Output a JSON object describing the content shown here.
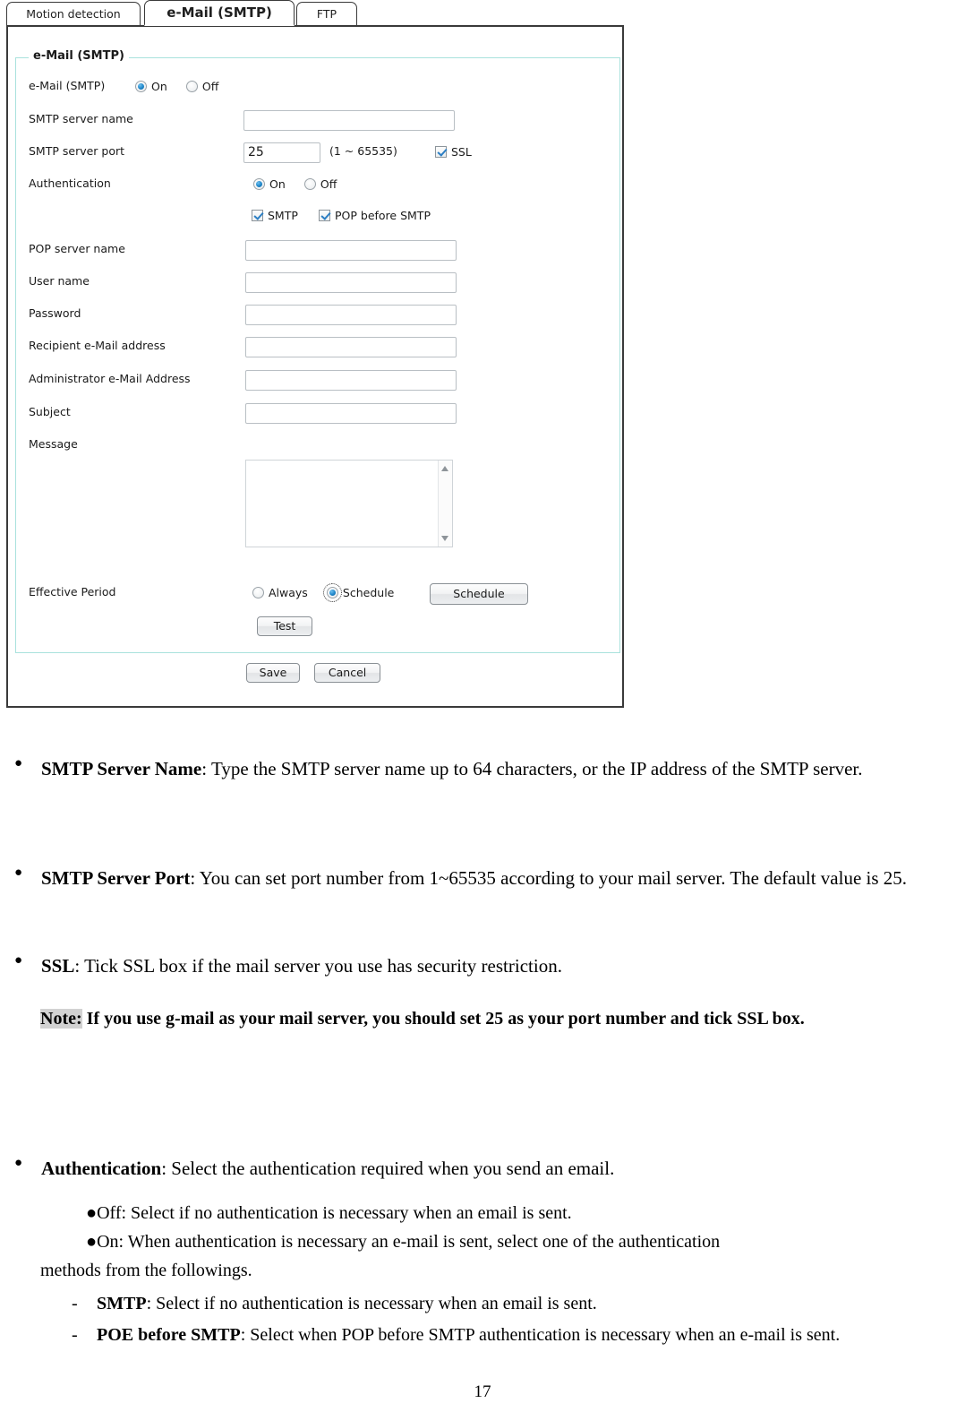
{
  "screenshot": {
    "tabs": [
      {
        "label": "Motion detection",
        "active": false
      },
      {
        "label": "e-Mail (SMTP)",
        "active": true
      },
      {
        "label": "FTP",
        "active": false
      }
    ],
    "fieldset_legend": "e-Mail (SMTP)",
    "colors": {
      "fieldset_border": "#a9e2dd",
      "panel_border": "#3a3a3a",
      "radio_selected": "#1f86c9",
      "checkbox_tick": "#2c7fc4",
      "note_highlight": "#d2d2d2"
    },
    "rows": {
      "email_toggle": {
        "label": "e-Mail (SMTP)",
        "options": [
          {
            "label": "On",
            "selected": true
          },
          {
            "label": "Off",
            "selected": false
          }
        ]
      },
      "smtp_server_name": {
        "label": "SMTP server name",
        "value": "",
        "placeholder": ""
      },
      "smtp_server_port": {
        "label": "SMTP server port",
        "value": "25",
        "range_hint": "(1 ~ 65535)",
        "ssl": {
          "label": "SSL",
          "checked": true
        }
      },
      "authentication": {
        "label": "Authentication",
        "options": [
          {
            "label": "On",
            "selected": true
          },
          {
            "label": "Off",
            "selected": false
          }
        ],
        "methods": [
          {
            "label": "SMTP",
            "checked": true
          },
          {
            "label": "POP before SMTP",
            "checked": true
          }
        ]
      },
      "pop_server_name": {
        "label": "POP server name",
        "value": ""
      },
      "user_name": {
        "label": "User name",
        "value": ""
      },
      "password": {
        "label": "Password",
        "value": ""
      },
      "recipient_email": {
        "label": "Recipient e-Mail address",
        "value": ""
      },
      "administrator_email": {
        "label": "Administrator e-Mail Address",
        "value": ""
      },
      "subject": {
        "label": "Subject",
        "value": ""
      },
      "message": {
        "label": "Message",
        "value": ""
      },
      "effective_period": {
        "label": "Effective Period",
        "options": [
          {
            "label": "Always",
            "selected": false
          },
          {
            "label": "Schedule",
            "selected": true
          }
        ],
        "schedule_button": "Schedule"
      },
      "test_button": "Test"
    },
    "footer_buttons": {
      "save": "Save",
      "cancel": "Cancel"
    }
  },
  "document": {
    "bullets": [
      {
        "glyph": "●",
        "term": "SMTP Server Name",
        "text": ": Type the SMTP server name up to 64 characters, or the IP address of the SMTP server."
      },
      {
        "glyph": "●",
        "term": "SMTP Server Port",
        "text": ": You can set port number from 1~65535 according to your mail server. The default value is 25."
      },
      {
        "glyph": "●",
        "term": "SSL",
        "text": ": Tick SSL box if the mail server you use has security restriction."
      }
    ],
    "note": {
      "label": "Note:",
      "text": " If you use g-mail as your mail server, you should set 25 as your port number and tick SSL box."
    },
    "auth_bullet": {
      "glyph": "●",
      "term": "Authentication",
      "text": ": Select the authentication required when you send an email."
    },
    "auth_sub_lines": [
      "●Off: Select if no authentication is necessary when an email is sent.",
      "●On: When authentication is necessary an e-mail is sent, select one of the authentication",
      "methods from the followings."
    ],
    "auth_dash_items": [
      {
        "dash": "-",
        "term": "SMTP",
        "text": ": Select if no authentication is necessary when an email is sent."
      },
      {
        "dash": "-",
        "term": "POE before SMTP",
        "text": ": Select when POP before SMTP authentication is necessary when an e-mail is sent."
      }
    ],
    "page_number": "17"
  }
}
